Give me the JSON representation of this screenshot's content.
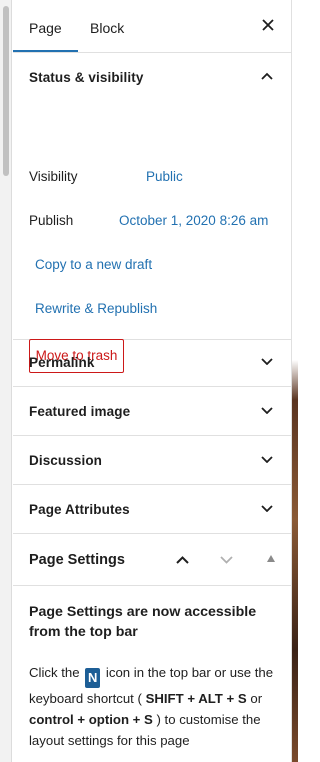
{
  "tabs": {
    "page": "Page",
    "block": "Block"
  },
  "status_visibility": {
    "title": "Status & visibility",
    "visibility_label": "Visibility",
    "visibility_value": "Public",
    "publish_label": "Publish",
    "publish_value": "October 1, 2020 8:26 am",
    "copy_draft": "Copy to a new draft",
    "rewrite_republish": "Rewrite & Republish",
    "trash": "Move to trash"
  },
  "panels": [
    "Permalink",
    "Featured image",
    "Discussion",
    "Page Attributes"
  ],
  "page_settings": {
    "title": "Page Settings",
    "notice_title": "Page Settings are now accessible from the top bar",
    "text_1": "Click the",
    "badge": "N",
    "text_2": "icon in the top bar or use the keyboard shortcut (",
    "shortcut_1": "SHIFT + ALT + S",
    "text_3": "or",
    "shortcut_2": "control + option + S",
    "text_4": ") to customise the layout settings for this page"
  },
  "colors": {
    "link": "#2271b1",
    "danger": "#cc1818",
    "tab_indicator": "#2271b1",
    "badge": "#1d5e96"
  },
  "icons": [
    "close-icon",
    "chevron-up-icon",
    "chevron-down-icon",
    "triangle-up-icon"
  ]
}
